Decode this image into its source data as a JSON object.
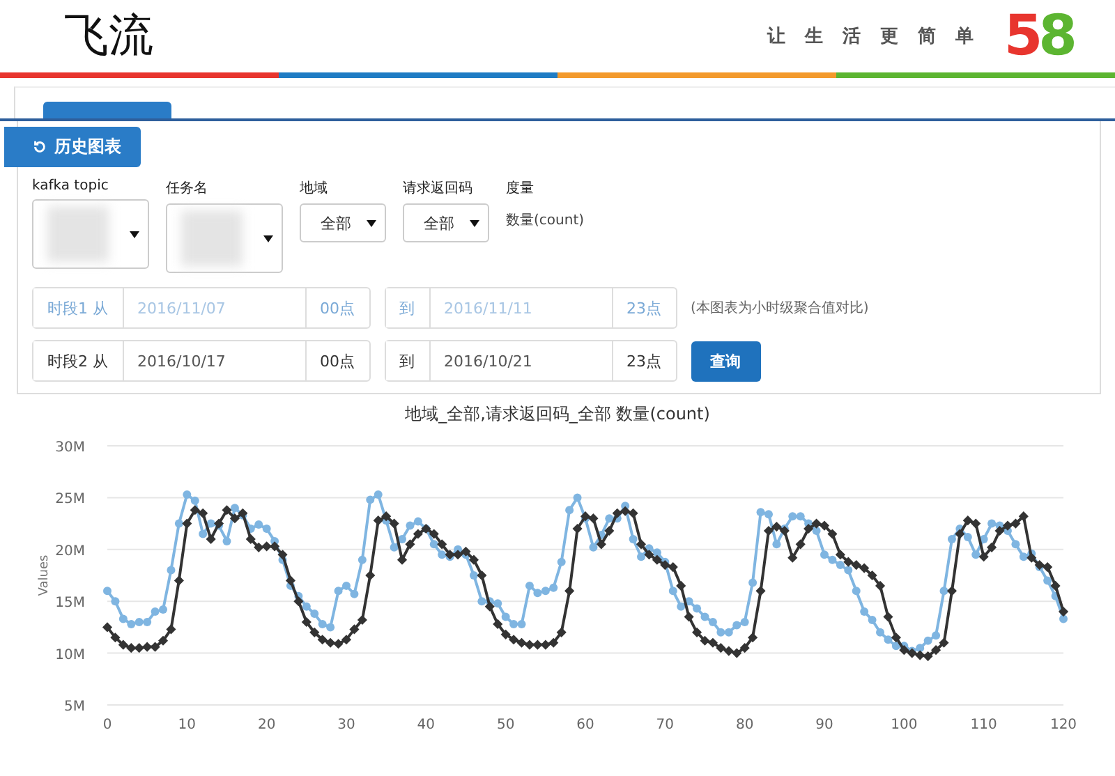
{
  "header": {
    "title": "飞流",
    "slogan": [
      "让",
      "生",
      "活",
      "更",
      "简",
      "单"
    ],
    "logo": "58"
  },
  "panel": {
    "tab": {
      "label": "历史图表",
      "selected": true
    },
    "filters": [
      {
        "label": "kafka topic",
        "kind": "blurred"
      },
      {
        "label": "任务名",
        "kind": "blurred"
      },
      {
        "label": "地域",
        "kind": "select",
        "value": "全部"
      },
      {
        "label": "请求返回码",
        "kind": "select",
        "value": "全部"
      },
      {
        "label": "度量",
        "kind": "text",
        "value": "数量(count)"
      }
    ],
    "periods": [
      {
        "label": "时段1 从",
        "from_date": "2016/11/07",
        "from_hour": "00点",
        "to_label": "到",
        "to_date": "2016/11/11",
        "to_hour": "23点",
        "disabled": true,
        "note": "(本图表为小时级聚合值对比)"
      },
      {
        "label": "时段2 从",
        "from_date": "2016/10/17",
        "from_hour": "00点",
        "to_label": "到",
        "to_date": "2016/10/21",
        "to_hour": "23点",
        "disabled": false,
        "button": "查询"
      }
    ]
  },
  "chart": {
    "chart_data": {
      "type": "line",
      "title": "地域_全部,请求返回码_全部 数量(count)",
      "ylabel": "Values",
      "grid": true,
      "x": [
        0,
        1,
        2,
        3,
        4,
        5,
        6,
        7,
        8,
        9,
        10,
        11,
        12,
        13,
        14,
        15,
        16,
        17,
        18,
        19,
        20,
        21,
        22,
        23,
        24,
        25,
        26,
        27,
        28,
        29,
        30,
        31,
        32,
        33,
        34,
        35,
        36,
        37,
        38,
        39,
        40,
        41,
        42,
        43,
        44,
        45,
        46,
        47,
        48,
        49,
        50,
        51,
        52,
        53,
        54,
        55,
        56,
        57,
        58,
        59,
        60,
        61,
        62,
        63,
        64,
        65,
        66,
        67,
        68,
        69,
        70,
        71,
        72,
        73,
        74,
        75,
        76,
        77,
        78,
        79,
        80,
        81,
        82,
        83,
        84,
        85,
        86,
        87,
        88,
        89,
        90,
        91,
        92,
        93,
        94,
        95,
        96,
        97,
        98,
        99,
        100,
        101,
        102,
        103,
        104,
        105,
        106,
        107,
        108,
        109,
        110,
        111,
        112,
        113,
        114,
        115,
        116,
        117,
        118,
        119,
        120
      ],
      "xlim": [
        0,
        120
      ],
      "ylim": [
        5,
        30
      ],
      "xticks": [
        0,
        10,
        20,
        30,
        40,
        50,
        60,
        70,
        80,
        90,
        100,
        110,
        120
      ],
      "yticks": [
        {
          "value": 5,
          "label": "5M"
        },
        {
          "value": 10,
          "label": "10M"
        },
        {
          "value": 15,
          "label": "15M"
        },
        {
          "value": 20,
          "label": "20M"
        },
        {
          "value": 25,
          "label": "25M"
        },
        {
          "value": 30,
          "label": "30M"
        }
      ],
      "series": [
        {
          "color": "#7fb5e1",
          "marker": "circle",
          "values": [
            16,
            15,
            13.3,
            12.8,
            13,
            13,
            14,
            14.2,
            18,
            22.5,
            25.3,
            24.7,
            21.5,
            22.5,
            22.3,
            20.8,
            24,
            23.3,
            22,
            22.4,
            22,
            20.8,
            19,
            16.5,
            15.5,
            14.5,
            13.8,
            12.8,
            12.5,
            16,
            16.5,
            15.7,
            19,
            24.8,
            25.3,
            22.8,
            20.2,
            21,
            22.3,
            22.7,
            22,
            20.5,
            19.5,
            19.3,
            20,
            19.5,
            17.5,
            15,
            15,
            14.8,
            13.5,
            12.8,
            12.8,
            16.5,
            15.8,
            16,
            16.3,
            18.8,
            23.8,
            25,
            23,
            20.2,
            21.4,
            23,
            23,
            24.2,
            21,
            19.3,
            20.1,
            19.7,
            18.8,
            16,
            14.5,
            15,
            14.3,
            13.5,
            13,
            12,
            12,
            12.7,
            13,
            16.8,
            23.6,
            23.4,
            20.5,
            22,
            23.2,
            23.2,
            22.5,
            21.8,
            19.5,
            19,
            18.5,
            18,
            16,
            14,
            13.2,
            12,
            11.3,
            10.7,
            10.7,
            10.2,
            10.5,
            11.2,
            11.7,
            16,
            21,
            22,
            21.2,
            19.5,
            21,
            22.5,
            22.3,
            21.8,
            20.5,
            19.3,
            19.6,
            18.3,
            17,
            15.5,
            13.3
          ]
        },
        {
          "color": "#333333",
          "marker": "diamond",
          "values": [
            12.5,
            11.5,
            10.8,
            10.5,
            10.5,
            10.6,
            10.6,
            11.2,
            12.3,
            17,
            22.5,
            23.8,
            23.5,
            21,
            22.5,
            23.8,
            23,
            23.5,
            21,
            20.2,
            20.3,
            20.3,
            19.5,
            17,
            15,
            13,
            12,
            11.3,
            11,
            10.9,
            11.3,
            12.3,
            13.2,
            17.5,
            22.8,
            23.2,
            22.5,
            19,
            20.5,
            21.5,
            22,
            21.5,
            20.5,
            19.5,
            19.5,
            19.8,
            19,
            17.5,
            14.5,
            12.8,
            11.8,
            11.3,
            11,
            10.8,
            10.8,
            10.8,
            11,
            12,
            16,
            22,
            23.2,
            23,
            20.5,
            21.8,
            23.5,
            23.7,
            23.5,
            20.5,
            19.5,
            19,
            18.5,
            18.3,
            16.5,
            13.5,
            12,
            11.2,
            11,
            10.5,
            10.2,
            10,
            10.5,
            11.5,
            16,
            21.8,
            22.2,
            21.8,
            19.2,
            20.5,
            22,
            22.5,
            22.3,
            21.5,
            19.5,
            18.8,
            18.5,
            18.2,
            17.5,
            16.5,
            13.5,
            11.5,
            10.3,
            10,
            9.8,
            9.7,
            10.3,
            11,
            16,
            21.5,
            22.8,
            22.5,
            19.3,
            20.2,
            21.8,
            22.3,
            22.5,
            23.2,
            19.2,
            18.5,
            18.3,
            16.5,
            14
          ]
        }
      ]
    }
  }
}
